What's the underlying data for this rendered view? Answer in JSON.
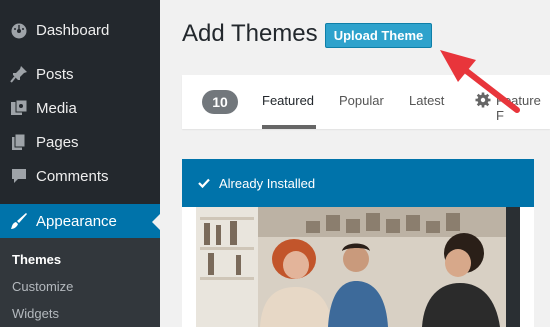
{
  "sidebar": {
    "items": [
      {
        "label": "Dashboard",
        "icon": "dashboard-icon"
      },
      {
        "label": "Posts",
        "icon": "pin-icon"
      },
      {
        "label": "Media",
        "icon": "media-icon"
      },
      {
        "label": "Pages",
        "icon": "pages-icon"
      },
      {
        "label": "Comments",
        "icon": "comment-icon"
      },
      {
        "label": "Appearance",
        "icon": "paintbrush-icon"
      }
    ],
    "submenu": [
      "Themes",
      "Customize",
      "Widgets"
    ]
  },
  "main": {
    "title": "Add Themes",
    "upload_button": "Upload Theme",
    "filter": {
      "count": "10",
      "tabs": [
        "Featured",
        "Popular",
        "Latest",
        "Feature F"
      ]
    },
    "card": {
      "notice": "Already Installed"
    }
  },
  "colors": {
    "sidebar": "#23282d",
    "accent": "#0073aa",
    "button": "#2ea2cc",
    "annotation": "#e8353b"
  }
}
